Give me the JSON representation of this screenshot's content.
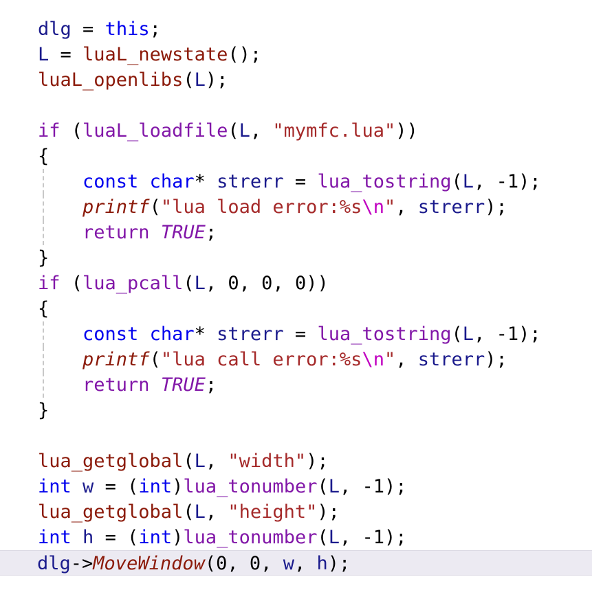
{
  "editor": {
    "language": "cpp",
    "background": "#ffffff",
    "current_line_highlight": "#eceaf2",
    "palette": {
      "identifier": "#1a1a8c",
      "keyword_blue": "#0000ee",
      "keyword_purple": "#8217a8",
      "function_purple": "#8217a8",
      "function_maroon": "#8b1a0a",
      "string": "#a52a2a",
      "escape": "#c000c0",
      "punctuation": "#000000",
      "indent_guide": "#c8c8c8"
    }
  },
  "code": {
    "l1": {
      "t1": "dlg",
      "t2": " = ",
      "t3": "this",
      "t4": ";"
    },
    "l2": {
      "t1": "L",
      "t2": " = ",
      "t3": "luaL_newstate",
      "t4": "();"
    },
    "l3": {
      "t1": "luaL_openlibs",
      "t2": "(",
      "t3": "L",
      "t4": ");"
    },
    "l4": {
      "t1": ""
    },
    "l5": {
      "t1": "if",
      "t2": " (",
      "t3": "luaL_loadfile",
      "t4": "(",
      "t5": "L",
      "t6": ", ",
      "t7": "\"mymfc.lua\"",
      "t8": "))"
    },
    "l6": {
      "t1": "{"
    },
    "l7": {
      "t1": "const",
      "t2": " ",
      "t3": "char",
      "t4": "* ",
      "t5": "strerr",
      "t6": " = ",
      "t7": "lua_tostring",
      "t8": "(",
      "t9": "L",
      "t10": ", ",
      "t11": "-1",
      "t12": ");"
    },
    "l8": {
      "t1": "printf",
      "t2": "(",
      "t3": "\"lua load error:%s",
      "t4": "\\n",
      "t5": "\"",
      "t6": ", ",
      "t7": "strerr",
      "t8": ");"
    },
    "l9": {
      "t1": "return",
      "t2": " ",
      "t3": "TRUE",
      "t4": ";"
    },
    "l10": {
      "t1": "}"
    },
    "l11": {
      "t1": "if",
      "t2": " (",
      "t3": "lua_pcall",
      "t4": "(",
      "t5": "L",
      "t6": ", ",
      "t7": "0",
      "t8": ", ",
      "t9": "0",
      "t10": ", ",
      "t11": "0",
      "t12": "))"
    },
    "l12": {
      "t1": "{"
    },
    "l13": {
      "t1": "const",
      "t2": " ",
      "t3": "char",
      "t4": "* ",
      "t5": "strerr",
      "t6": " = ",
      "t7": "lua_tostring",
      "t8": "(",
      "t9": "L",
      "t10": ", ",
      "t11": "-1",
      "t12": ");"
    },
    "l14": {
      "t1": "printf",
      "t2": "(",
      "t3": "\"lua call error:%s",
      "t4": "\\n",
      "t5": "\"",
      "t6": ", ",
      "t7": "strerr",
      "t8": ");"
    },
    "l15": {
      "t1": "return",
      "t2": " ",
      "t3": "TRUE",
      "t4": ";"
    },
    "l16": {
      "t1": "}"
    },
    "l17": {
      "t1": ""
    },
    "l18": {
      "t1": "lua_getglobal",
      "t2": "(",
      "t3": "L",
      "t4": ", ",
      "t5": "\"width\"",
      "t6": ");"
    },
    "l19": {
      "t1": "int",
      "t2": " ",
      "t3": "w",
      "t4": " = (",
      "t5": "int",
      "t6": ")",
      "t7": "lua_tonumber",
      "t8": "(",
      "t9": "L",
      "t10": ", ",
      "t11": "-1",
      "t12": ");"
    },
    "l20": {
      "t1": "lua_getglobal",
      "t2": "(",
      "t3": "L",
      "t4": ", ",
      "t5": "\"height\"",
      "t6": ");"
    },
    "l21": {
      "t1": "int",
      "t2": " ",
      "t3": "h",
      "t4": " = (",
      "t5": "int",
      "t6": ")",
      "t7": "lua_tonumber",
      "t8": "(",
      "t9": "L",
      "t10": ", ",
      "t11": "-1",
      "t12": ");"
    },
    "l22": {
      "t1": "dlg",
      "t2": "->",
      "t3": "MoveWindow",
      "t4": "(",
      "t5": "0",
      "t6": ", ",
      "t7": "0",
      "t8": ", ",
      "t9": "w",
      "t10": ", ",
      "t11": "h",
      "t12": ");"
    }
  }
}
